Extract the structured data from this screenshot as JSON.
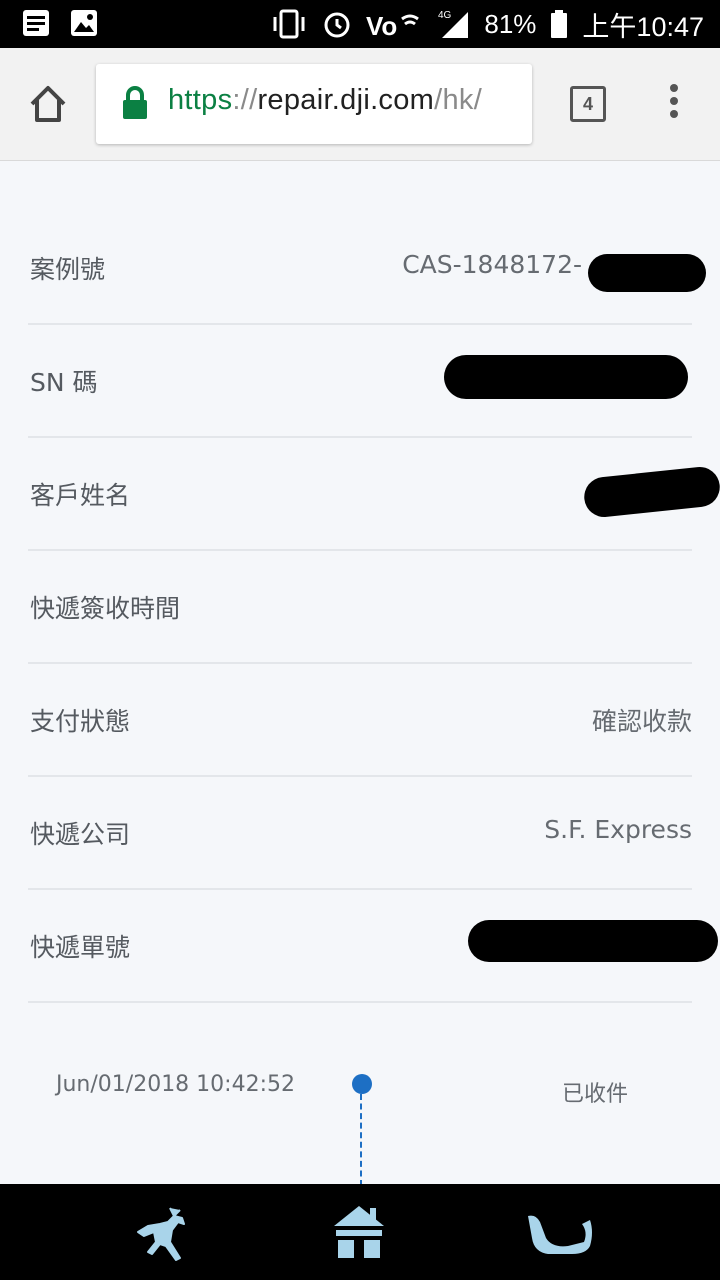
{
  "status_bar": {
    "battery": "81%",
    "time": "上午10:47",
    "network": "4G"
  },
  "browser": {
    "url_scheme": "https",
    "url_sep": "://",
    "url_host": "repair.dji.com",
    "url_path": "/hk/",
    "tab_count": "4"
  },
  "info_rows": [
    {
      "label": "案例號",
      "value": "CAS-1848172-"
    },
    {
      "label": "SN 碼",
      "value": ""
    },
    {
      "label": "客戶姓名",
      "value": ""
    },
    {
      "label": "快遞簽收時間",
      "value": ""
    },
    {
      "label": "支付狀態",
      "value": "確認收款"
    },
    {
      "label": "快遞公司",
      "value": "S.F. Express"
    },
    {
      "label": "快遞單號",
      "value": ""
    }
  ],
  "timeline": {
    "date": "Jun/01/2018 10:42:52",
    "status": "已收件"
  },
  "colors": {
    "accent": "#1d6fc4",
    "url_green": "#0b8043",
    "nav_icon": "#a9d4ea"
  },
  "icons": {
    "nav": [
      "reindeer-icon",
      "house-icon",
      "sleigh-icon"
    ]
  }
}
